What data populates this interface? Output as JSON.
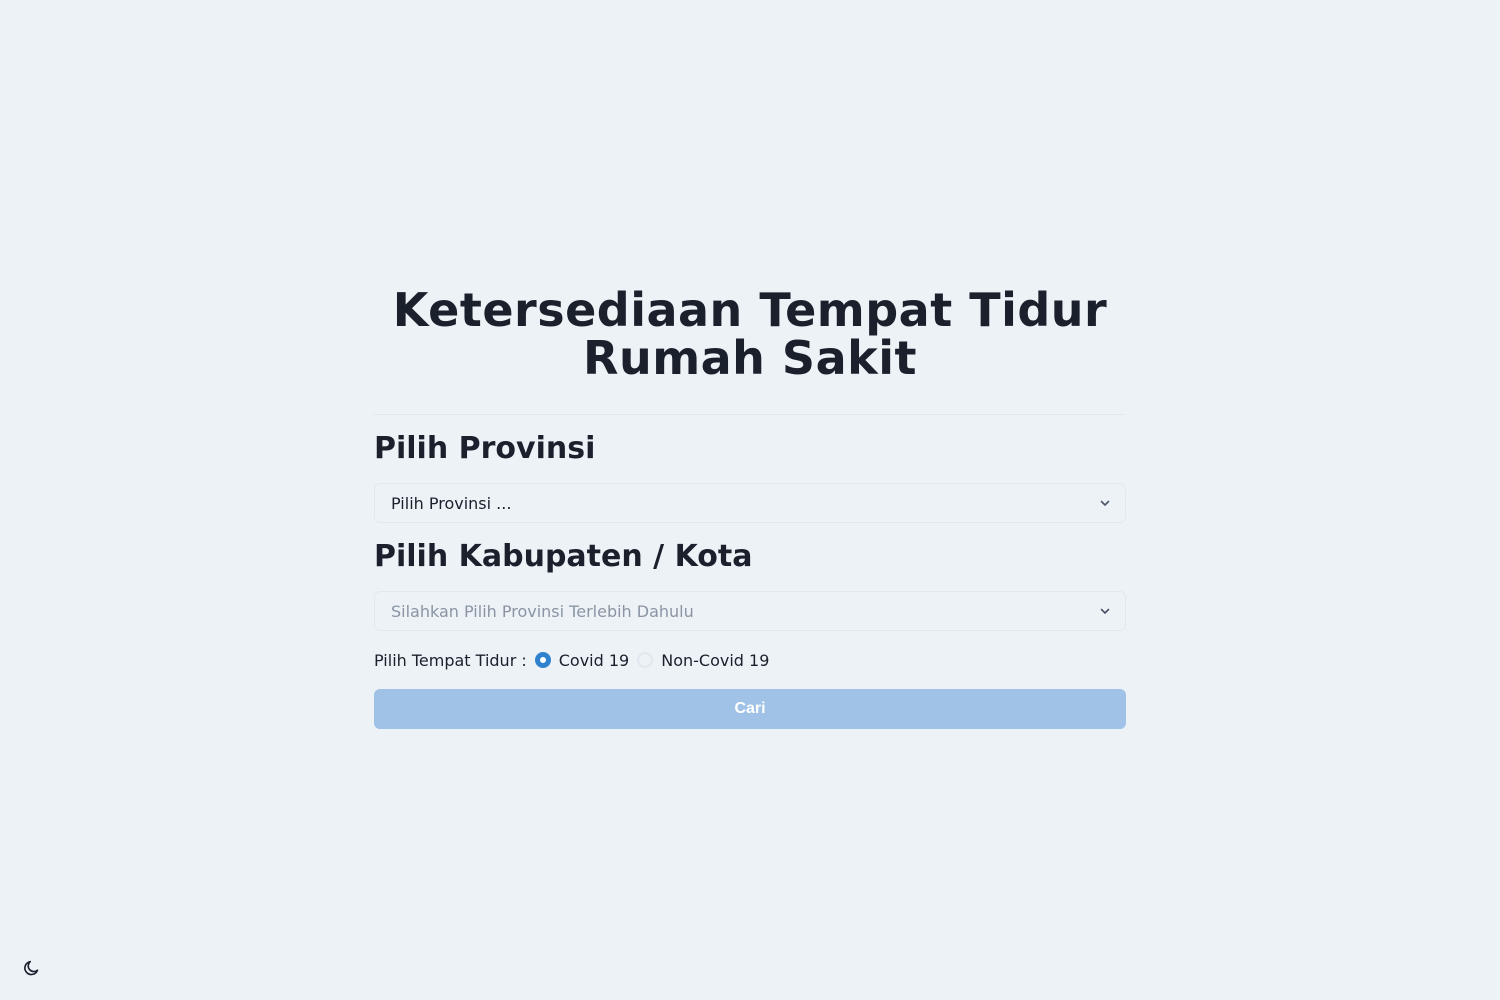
{
  "title": "Ketersediaan Tempat Tidur Rumah Sakit",
  "province": {
    "heading": "Pilih Provinsi",
    "selected": "Pilih Provinsi ..."
  },
  "city": {
    "heading": "Pilih Kabupaten / Kota",
    "selected": "Silahkan Pilih Provinsi Terlebih Dahulu"
  },
  "bed_type": {
    "label": "Pilih Tempat Tidur :",
    "options": [
      "Covid 19",
      "Non-Covid 19"
    ],
    "selected": "Covid 19"
  },
  "search_button": "Cari",
  "colors": {
    "background": "#edf2f7",
    "accent": "#3182ce",
    "button_disabled": "#a0c2e6"
  },
  "icons": {
    "theme_toggle": "moon-icon",
    "select_chevron": "chevron-down-icon"
  }
}
